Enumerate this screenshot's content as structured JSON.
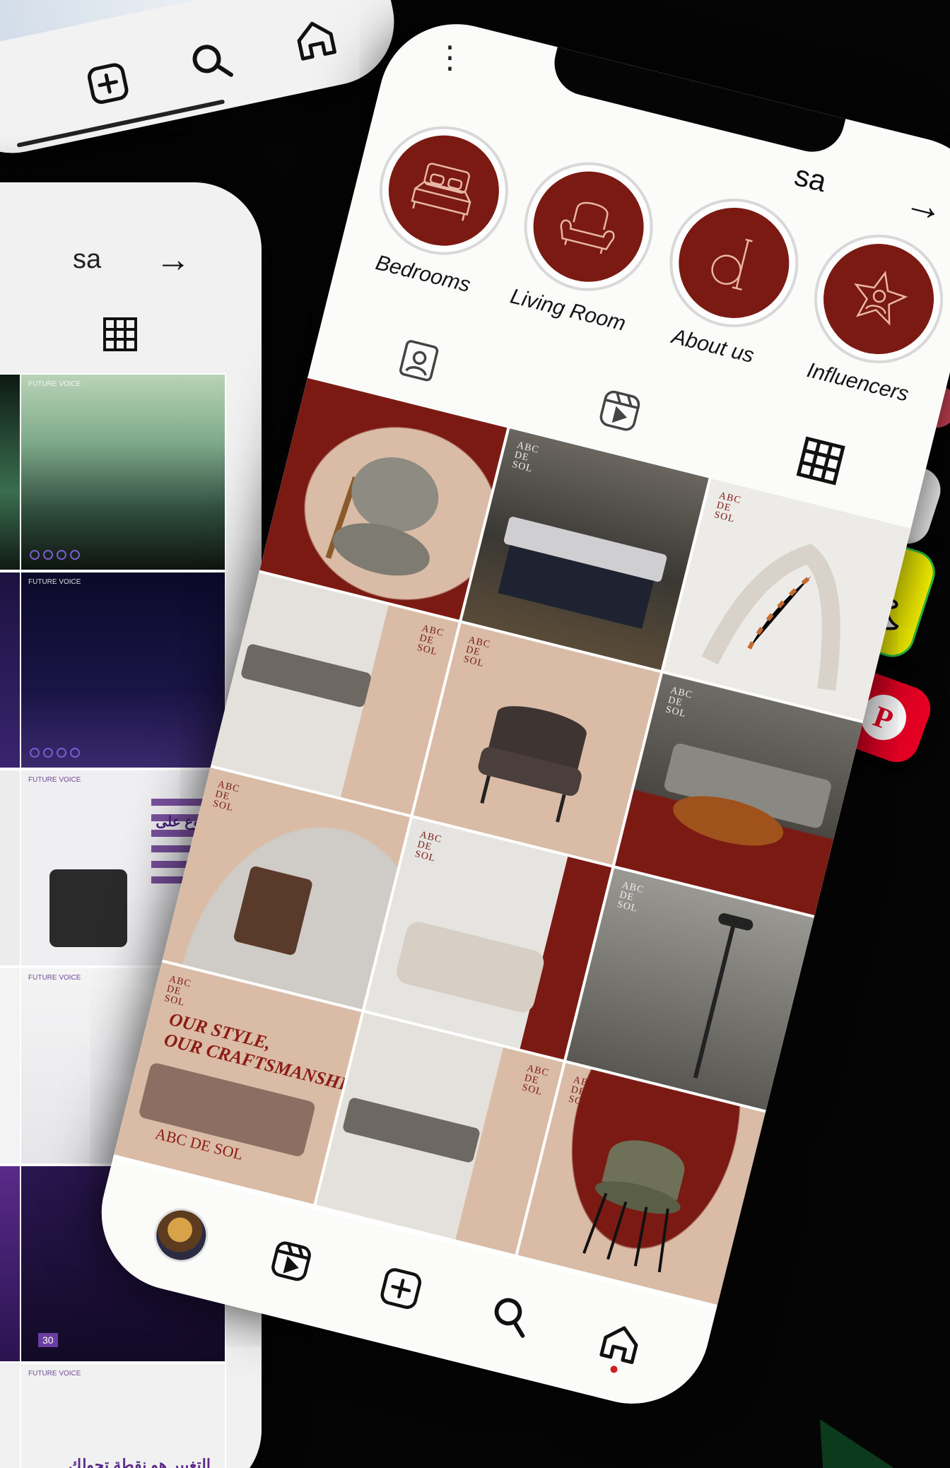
{
  "top_phone": {
    "nav_icons": [
      "add-icon",
      "search-icon",
      "home-icon"
    ]
  },
  "left_phone": {
    "handle": "sa",
    "back_icon": "arrow-right-icon",
    "grid_icon": "grid-icon",
    "tile_brand": "FUTURE VOICE",
    "tiles_arabic": [
      "أروع على",
      "التغيير هو نقطة تحولك"
    ],
    "date_badge": "30"
  },
  "main_phone": {
    "handle": "sa",
    "more_icon": "more-vertical-icon",
    "back_icon": "arrow-right-icon",
    "highlights": [
      {
        "label": "Bedrooms",
        "icon": "bed-icon"
      },
      {
        "label": "Living Room",
        "icon": "armchair-icon"
      },
      {
        "label": "About us",
        "icon": "logo-d-icon"
      },
      {
        "label": "Influencers",
        "icon": "star-person-icon"
      }
    ],
    "tabs": [
      {
        "name": "tagged",
        "icon": "contact-icon"
      },
      {
        "name": "reels",
        "icon": "reels-icon"
      },
      {
        "name": "posts",
        "icon": "grid-icon",
        "active": true
      }
    ],
    "brand_mark": "ABC\nDE\nSOL",
    "post_text": {
      "tagline": "OUR STYLE,\nOUR CRAFTSMANSHIP",
      "wordmark": "ABC DE SOL"
    },
    "bottom_nav": [
      "avatar",
      "reels-icon",
      "add-icon",
      "search-icon",
      "home-icon"
    ]
  },
  "apps": [
    "pinterest-icon",
    "snapchat-icon",
    "telegram-icon",
    "pinterest-icon"
  ],
  "colors": {
    "maroon": "#7b1a12",
    "beige": "#d9bba6",
    "snap_yellow": "#fffc00",
    "pinterest_red": "#e60023",
    "telegram_blue": "#2aa3e0"
  }
}
